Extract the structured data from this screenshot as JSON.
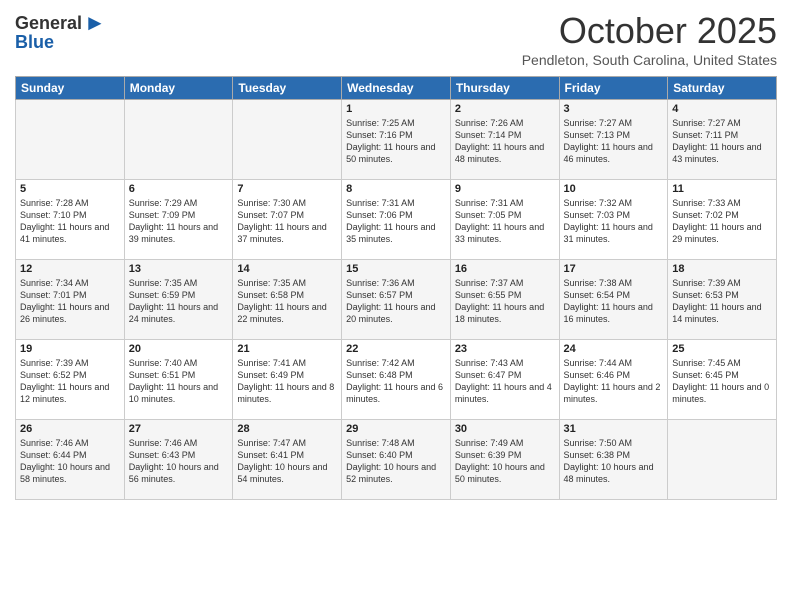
{
  "logo": {
    "general": "General",
    "blue": "Blue"
  },
  "title": "October 2025",
  "location": "Pendleton, South Carolina, United States",
  "days_header": [
    "Sunday",
    "Monday",
    "Tuesday",
    "Wednesday",
    "Thursday",
    "Friday",
    "Saturday"
  ],
  "weeks": [
    [
      {
        "day": "",
        "sunrise": "",
        "sunset": "",
        "daylight": ""
      },
      {
        "day": "",
        "sunrise": "",
        "sunset": "",
        "daylight": ""
      },
      {
        "day": "",
        "sunrise": "",
        "sunset": "",
        "daylight": ""
      },
      {
        "day": "1",
        "sunrise": "Sunrise: 7:25 AM",
        "sunset": "Sunset: 7:16 PM",
        "daylight": "Daylight: 11 hours and 50 minutes."
      },
      {
        "day": "2",
        "sunrise": "Sunrise: 7:26 AM",
        "sunset": "Sunset: 7:14 PM",
        "daylight": "Daylight: 11 hours and 48 minutes."
      },
      {
        "day": "3",
        "sunrise": "Sunrise: 7:27 AM",
        "sunset": "Sunset: 7:13 PM",
        "daylight": "Daylight: 11 hours and 46 minutes."
      },
      {
        "day": "4",
        "sunrise": "Sunrise: 7:27 AM",
        "sunset": "Sunset: 7:11 PM",
        "daylight": "Daylight: 11 hours and 43 minutes."
      }
    ],
    [
      {
        "day": "5",
        "sunrise": "Sunrise: 7:28 AM",
        "sunset": "Sunset: 7:10 PM",
        "daylight": "Daylight: 11 hours and 41 minutes."
      },
      {
        "day": "6",
        "sunrise": "Sunrise: 7:29 AM",
        "sunset": "Sunset: 7:09 PM",
        "daylight": "Daylight: 11 hours and 39 minutes."
      },
      {
        "day": "7",
        "sunrise": "Sunrise: 7:30 AM",
        "sunset": "Sunset: 7:07 PM",
        "daylight": "Daylight: 11 hours and 37 minutes."
      },
      {
        "day": "8",
        "sunrise": "Sunrise: 7:31 AM",
        "sunset": "Sunset: 7:06 PM",
        "daylight": "Daylight: 11 hours and 35 minutes."
      },
      {
        "day": "9",
        "sunrise": "Sunrise: 7:31 AM",
        "sunset": "Sunset: 7:05 PM",
        "daylight": "Daylight: 11 hours and 33 minutes."
      },
      {
        "day": "10",
        "sunrise": "Sunrise: 7:32 AM",
        "sunset": "Sunset: 7:03 PM",
        "daylight": "Daylight: 11 hours and 31 minutes."
      },
      {
        "day": "11",
        "sunrise": "Sunrise: 7:33 AM",
        "sunset": "Sunset: 7:02 PM",
        "daylight": "Daylight: 11 hours and 29 minutes."
      }
    ],
    [
      {
        "day": "12",
        "sunrise": "Sunrise: 7:34 AM",
        "sunset": "Sunset: 7:01 PM",
        "daylight": "Daylight: 11 hours and 26 minutes."
      },
      {
        "day": "13",
        "sunrise": "Sunrise: 7:35 AM",
        "sunset": "Sunset: 6:59 PM",
        "daylight": "Daylight: 11 hours and 24 minutes."
      },
      {
        "day": "14",
        "sunrise": "Sunrise: 7:35 AM",
        "sunset": "Sunset: 6:58 PM",
        "daylight": "Daylight: 11 hours and 22 minutes."
      },
      {
        "day": "15",
        "sunrise": "Sunrise: 7:36 AM",
        "sunset": "Sunset: 6:57 PM",
        "daylight": "Daylight: 11 hours and 20 minutes."
      },
      {
        "day": "16",
        "sunrise": "Sunrise: 7:37 AM",
        "sunset": "Sunset: 6:55 PM",
        "daylight": "Daylight: 11 hours and 18 minutes."
      },
      {
        "day": "17",
        "sunrise": "Sunrise: 7:38 AM",
        "sunset": "Sunset: 6:54 PM",
        "daylight": "Daylight: 11 hours and 16 minutes."
      },
      {
        "day": "18",
        "sunrise": "Sunrise: 7:39 AM",
        "sunset": "Sunset: 6:53 PM",
        "daylight": "Daylight: 11 hours and 14 minutes."
      }
    ],
    [
      {
        "day": "19",
        "sunrise": "Sunrise: 7:39 AM",
        "sunset": "Sunset: 6:52 PM",
        "daylight": "Daylight: 11 hours and 12 minutes."
      },
      {
        "day": "20",
        "sunrise": "Sunrise: 7:40 AM",
        "sunset": "Sunset: 6:51 PM",
        "daylight": "Daylight: 11 hours and 10 minutes."
      },
      {
        "day": "21",
        "sunrise": "Sunrise: 7:41 AM",
        "sunset": "Sunset: 6:49 PM",
        "daylight": "Daylight: 11 hours and 8 minutes."
      },
      {
        "day": "22",
        "sunrise": "Sunrise: 7:42 AM",
        "sunset": "Sunset: 6:48 PM",
        "daylight": "Daylight: 11 hours and 6 minutes."
      },
      {
        "day": "23",
        "sunrise": "Sunrise: 7:43 AM",
        "sunset": "Sunset: 6:47 PM",
        "daylight": "Daylight: 11 hours and 4 minutes."
      },
      {
        "day": "24",
        "sunrise": "Sunrise: 7:44 AM",
        "sunset": "Sunset: 6:46 PM",
        "daylight": "Daylight: 11 hours and 2 minutes."
      },
      {
        "day": "25",
        "sunrise": "Sunrise: 7:45 AM",
        "sunset": "Sunset: 6:45 PM",
        "daylight": "Daylight: 11 hours and 0 minutes."
      }
    ],
    [
      {
        "day": "26",
        "sunrise": "Sunrise: 7:46 AM",
        "sunset": "Sunset: 6:44 PM",
        "daylight": "Daylight: 10 hours and 58 minutes."
      },
      {
        "day": "27",
        "sunrise": "Sunrise: 7:46 AM",
        "sunset": "Sunset: 6:43 PM",
        "daylight": "Daylight: 10 hours and 56 minutes."
      },
      {
        "day": "28",
        "sunrise": "Sunrise: 7:47 AM",
        "sunset": "Sunset: 6:41 PM",
        "daylight": "Daylight: 10 hours and 54 minutes."
      },
      {
        "day": "29",
        "sunrise": "Sunrise: 7:48 AM",
        "sunset": "Sunset: 6:40 PM",
        "daylight": "Daylight: 10 hours and 52 minutes."
      },
      {
        "day": "30",
        "sunrise": "Sunrise: 7:49 AM",
        "sunset": "Sunset: 6:39 PM",
        "daylight": "Daylight: 10 hours and 50 minutes."
      },
      {
        "day": "31",
        "sunrise": "Sunrise: 7:50 AM",
        "sunset": "Sunset: 6:38 PM",
        "daylight": "Daylight: 10 hours and 48 minutes."
      },
      {
        "day": "",
        "sunrise": "",
        "sunset": "",
        "daylight": ""
      }
    ]
  ]
}
